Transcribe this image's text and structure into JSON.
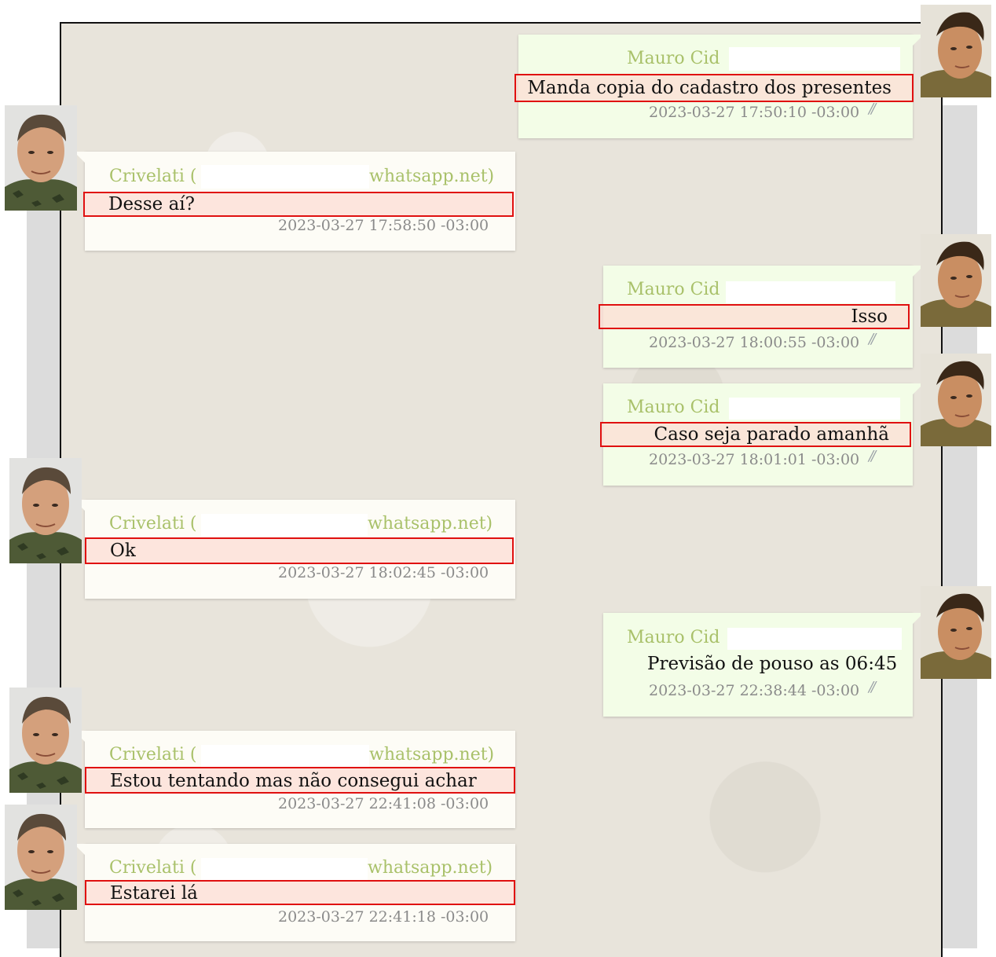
{
  "chat": {
    "messages": [
      {
        "sender": "Mauro Cid",
        "text": "Manda copia do cadastro dos presentes",
        "time": "2023-03-27 17:50:10 -03:00",
        "direction": "outgoing"
      },
      {
        "sender": "Crivelati (",
        "sender_suffix": "whatsapp.net)",
        "text": "Desse aí?",
        "time": "2023-03-27 17:58:50 -03:00",
        "direction": "incoming"
      },
      {
        "sender": "Mauro Cid",
        "text": "Isso",
        "time": "2023-03-27 18:00:55 -03:00",
        "direction": "outgoing"
      },
      {
        "sender": "Mauro Cid",
        "text": "Caso seja parado amanhã",
        "time": "2023-03-27 18:01:01 -03:00",
        "direction": "outgoing"
      },
      {
        "sender": "Crivelati (",
        "sender_suffix": "whatsapp.net)",
        "text": "Ok",
        "time": "2023-03-27 18:02:45 -03:00",
        "direction": "incoming"
      },
      {
        "sender": "Mauro Cid",
        "text": "Previsão de pouso as 06:45",
        "time": "2023-03-27 22:38:44 -03:00",
        "direction": "outgoing"
      },
      {
        "sender": "Crivelati (",
        "sender_suffix": "whatsapp.net)",
        "text": "Estou tentando mas não consegui achar",
        "time": "2023-03-27 22:41:08 -03:00",
        "direction": "incoming"
      },
      {
        "sender": "Crivelati (",
        "sender_suffix": "whatsapp.net)",
        "text": "Estarei lá",
        "time": "2023-03-27 22:41:18 -03:00",
        "direction": "incoming"
      }
    ],
    "read_ticks": "//",
    "colors": {
      "sender_name": "#a9c16a",
      "highlight_border": "#e01010",
      "outgoing_bubble": "#f3fde7",
      "incoming_bubble": "#fdfcf6"
    }
  }
}
